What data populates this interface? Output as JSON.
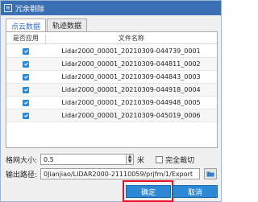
{
  "window": {
    "title": "冗余剔除"
  },
  "tabs": [
    {
      "label": "点云数据",
      "active": true
    },
    {
      "label": "轨迹数据",
      "active": false
    }
  ],
  "grid": {
    "headers": {
      "apply": "是否应用",
      "filename": "文件名称"
    },
    "rows": [
      {
        "checked": true,
        "filename": "Lidar2000_00001_20210309-044739_0001"
      },
      {
        "checked": true,
        "filename": "Lidar2000_00001_20210309-044811_0002"
      },
      {
        "checked": true,
        "filename": "Lidar2000_00001_20210309-044843_0003"
      },
      {
        "checked": true,
        "filename": "Lidar2000_00001_20210309-044918_0004"
      },
      {
        "checked": true,
        "filename": "Lidar2000_00001_20210309-044948_0005"
      },
      {
        "checked": true,
        "filename": "Lidar2000_00001_20210309-045019_0006"
      }
    ]
  },
  "form": {
    "grid_size_label": "格网大小:",
    "grid_size_value": "0.5",
    "unit": "米",
    "full_clip_label": "完全裁切",
    "full_clip_checked": false,
    "output_path_label": "输出路径:",
    "output_path_value": "0Jianjiao/LIDAR2000-21110059/prjfm/1/Export"
  },
  "buttons": {
    "ok": "确定",
    "cancel": "取消"
  },
  "colors": {
    "titlebar": "#3b6fb3",
    "accent": "#2d89d6",
    "highlight": "#e5122a"
  }
}
